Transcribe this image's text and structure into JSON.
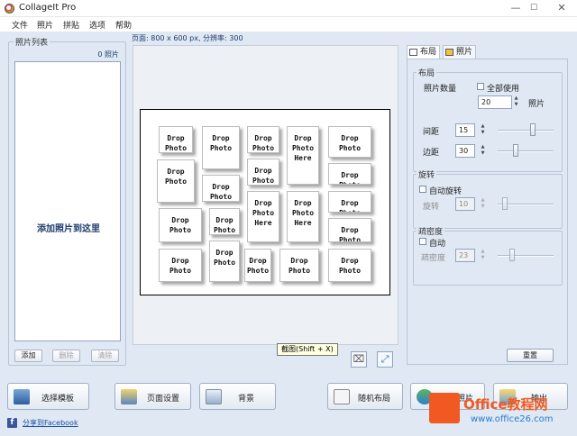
{
  "window": {
    "title": "CollageIt Pro",
    "minimize": "—",
    "maximize": "☐",
    "close": "✕"
  },
  "menu": [
    "文件",
    "照片",
    "拼贴",
    "选项",
    "帮助"
  ],
  "photo_list": {
    "title": "照片列表",
    "count": "0 照片",
    "drop_hint": "添加照片到这里",
    "add": "添加",
    "remove": "删除",
    "clear": "清除"
  },
  "page_info": "页面: 800 x 600 px, 分辨率: 300",
  "collage": {
    "tiles": [
      "Drop\nPhoto",
      "Drop\nPhoto",
      "Drop\nPhoto",
      "Drop\nPhoto\nHere",
      "Drop\nPhoto",
      "Drop\nPhoto",
      "Drop\nPhoto",
      "Drop\nPhoto",
      "Drop\nPhoto",
      "Drop\nPhoto",
      "Drop\nPhoto",
      "Drop\nPhoto\nHere",
      "Drop\nPhoto\nHere",
      "Drop\nPhoto",
      "Drop\nPhoto",
      "Drop\nPhoto",
      "Drop\nPhoto",
      "Drop\nPhoto",
      "Drop\nPhoto",
      "Drop\nPhoto"
    ]
  },
  "tooltip": "截图(Shift + X)",
  "tabs": {
    "layout": "布局",
    "photo": "照片"
  },
  "layout": {
    "group": "布局",
    "photo_count_label": "照片数量",
    "use_all": "全部使用",
    "photo_count": "20",
    "photo_unit": "照片",
    "spacing_label": "间距",
    "spacing": "15",
    "margin_label": "边距",
    "margin": "30"
  },
  "rotation": {
    "group": "旋转",
    "auto": "自动旋转",
    "label": "旋转",
    "value": "10"
  },
  "density": {
    "group": "疏密度",
    "auto": "自动",
    "label": "疏密度",
    "value": "23"
  },
  "reset": "重置",
  "bottom_buttons": {
    "template": "选择模板",
    "page_setup": "页面设置",
    "background": "背景",
    "random_layout": "随机布局",
    "shuffle": "交换照片",
    "export": "输出"
  },
  "share": "分享到Facebook",
  "watermark": {
    "brand": "Office教程网",
    "url": "www.office26.com"
  },
  "icons": {
    "app": "app-icon",
    "zoom_out": "shrink-icon",
    "fit": "fit-icon",
    "template": "template-icon",
    "page_setup": "page-setup-icon",
    "background": "background-icon",
    "random": "dice-icon",
    "shuffle": "swap-icon",
    "export": "export-icon",
    "facebook": "facebook-icon"
  }
}
